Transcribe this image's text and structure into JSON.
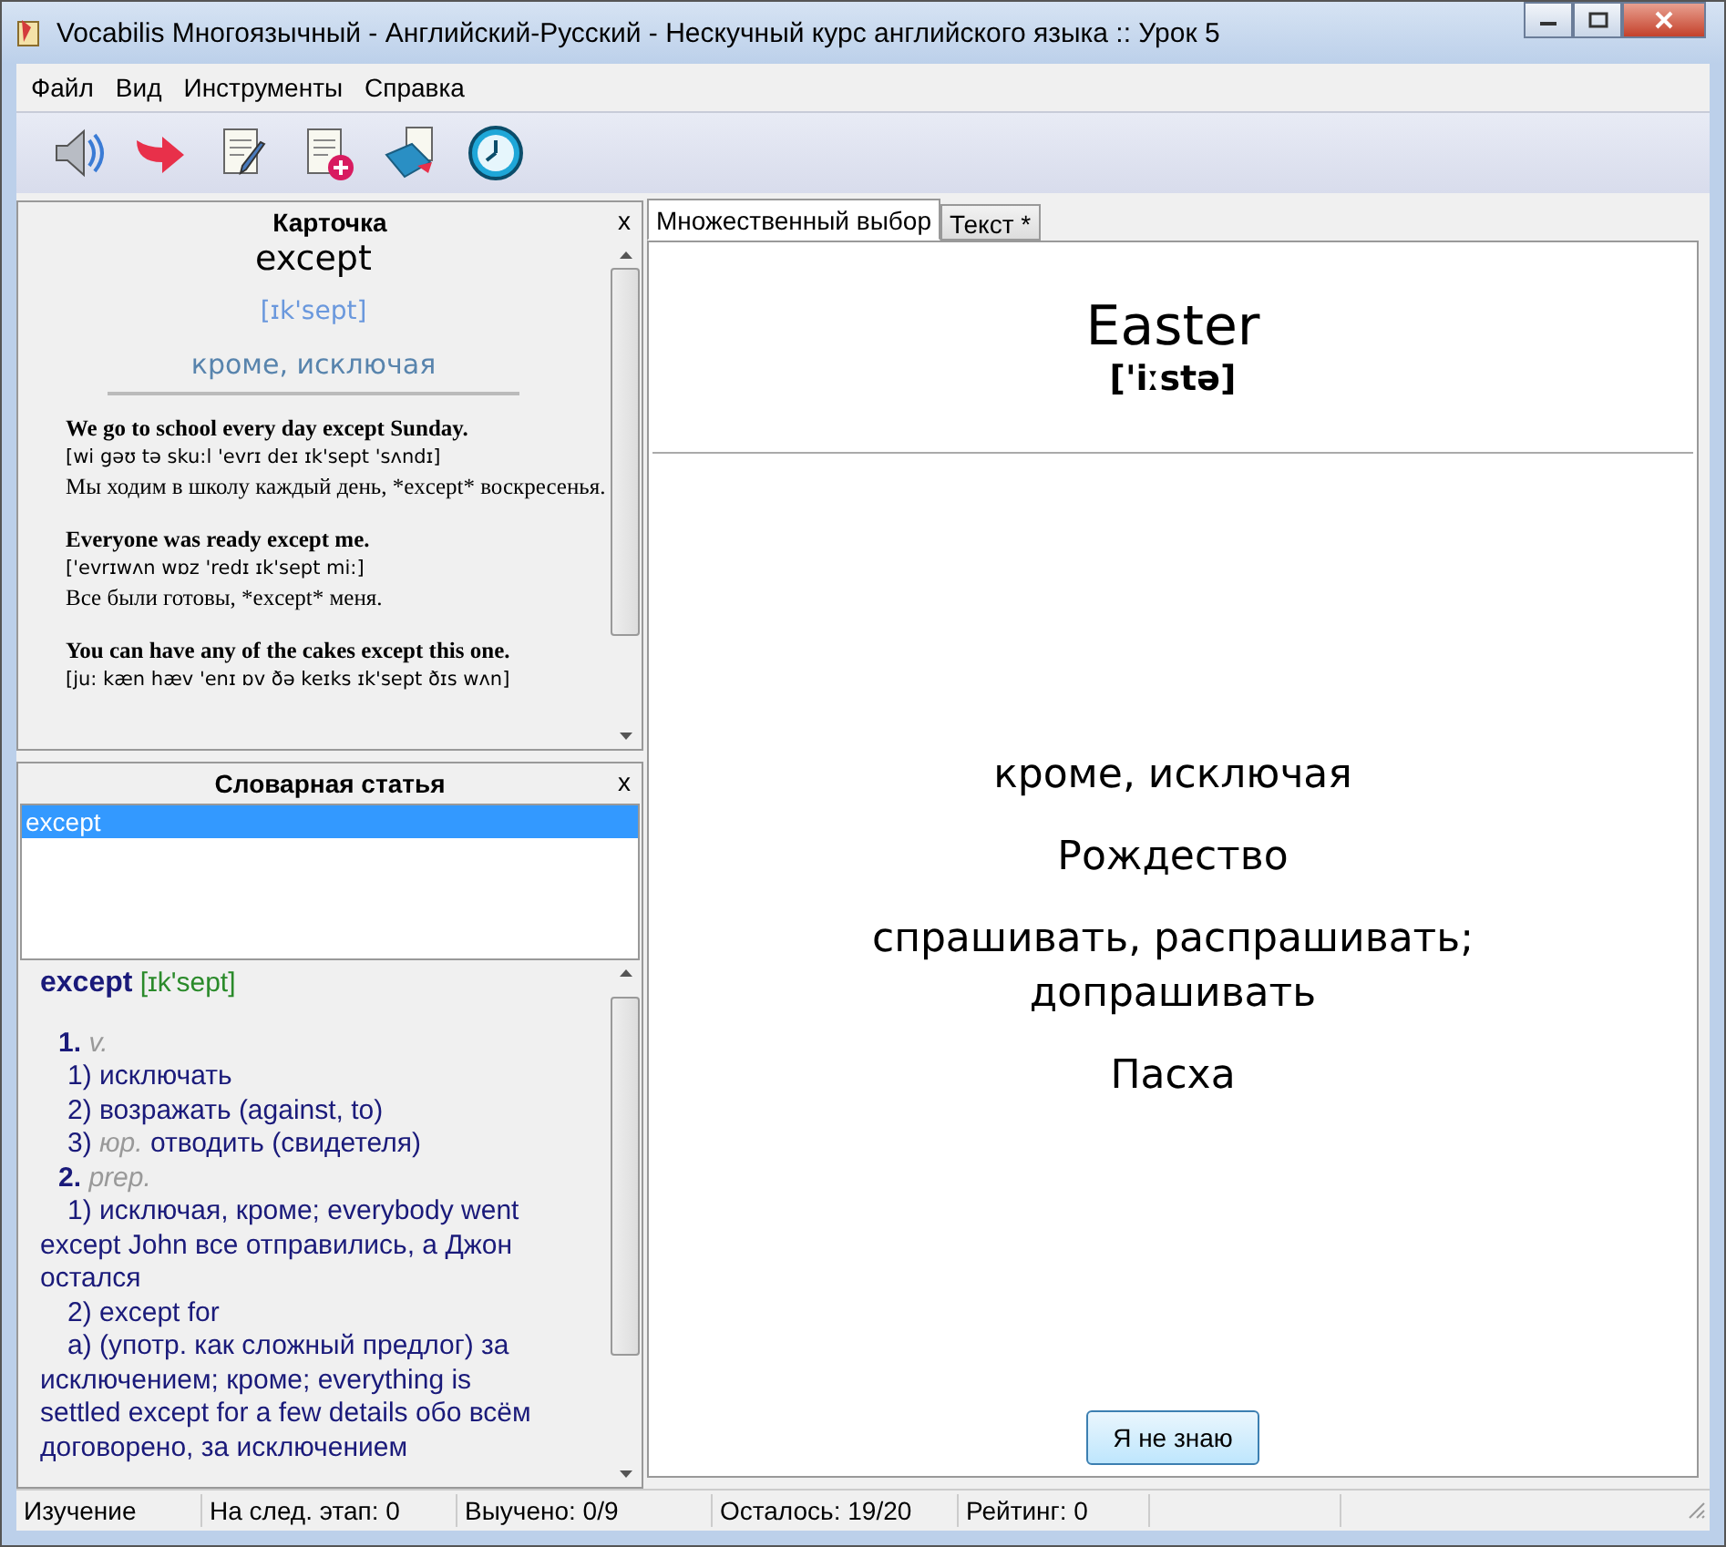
{
  "window": {
    "title": "Vocabilis Многоязычный - Английский-Русский - Нескучный курс английского языка :: Урок 5"
  },
  "menu": [
    "Файл",
    "Вид",
    "Инструменты",
    "Справка"
  ],
  "card": {
    "title": "Карточка",
    "close": "x",
    "word": "except",
    "transcription": "[ɪk'sept]",
    "translation": "кроме, исключая",
    "examples": [
      {
        "en": "We go to school every day except Sunday.",
        "ipa": "[wi gəʊ tə sku:l 'evrɪ deɪ ɪk'sept 'sʌndɪ]",
        "ru": "Мы ходим в школу каждый день, *except* воскресенья."
      },
      {
        "en": "Everyone was ready except me.",
        "ipa": "['evrɪwʌn wɒz 'redɪ ɪk'sept mi:]",
        "ru": "Все были готовы, *except* меня."
      },
      {
        "en": "You can have any of the cakes except this one.",
        "ipa": "[ju: kæn hæv 'enɪ ɒv ðə keɪks ɪk'sept ðɪs wʌn]"
      }
    ]
  },
  "dictionary": {
    "title": "Словарная статья",
    "close": "x",
    "list": [
      {
        "label": "except",
        "selected": true
      }
    ],
    "headword": "except",
    "transcription": "[ɪk'sept]",
    "lines": [
      {
        "kind": "pos",
        "number": "1.",
        "label": "v."
      },
      {
        "kind": "meaning",
        "text": "1) исключать"
      },
      {
        "kind": "meaning",
        "text": "2) возражать (against, to)"
      },
      {
        "kind": "meaning",
        "text": "3)",
        "label": "юр.",
        "rest": "отводить (свидетеля)"
      },
      {
        "kind": "pos",
        "number": "2.",
        "label": "prep."
      },
      {
        "kind": "para",
        "text": "1) исключая, кроме; everybody went except John все отправились, а Джон остался"
      },
      {
        "kind": "para",
        "text": "2) except for"
      },
      {
        "kind": "para",
        "text": "а) (употр. как сложный предлог) за исключением; кроме; everything is settled except for a few details обо всём договорено, за исключением"
      }
    ]
  },
  "tabs": [
    {
      "label": "Множественный выбор",
      "selected": true
    },
    {
      "label": "Текст *",
      "selected": false
    }
  ],
  "quiz": {
    "word": "Easter",
    "transcription": "['iːstə]",
    "options": [
      "кроме, исключая",
      "Рождество",
      "спрашивать, распрашивать; допрашивать",
      "Пасха"
    ],
    "button": "Я не знаю"
  },
  "status_bar": [
    "Изучение",
    "На след. этап: 0",
    "Выучено: 0/9",
    "Осталось: 19/20",
    "Рейтинг: 0"
  ]
}
